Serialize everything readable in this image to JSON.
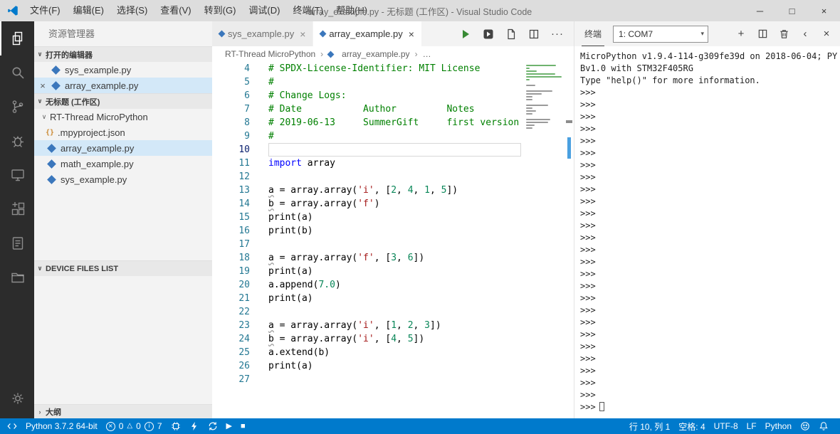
{
  "window": {
    "title": "array_example.py - 无标题 (工作区) - Visual Studio Code",
    "menus": [
      {
        "id": "file",
        "label": "文件(F)"
      },
      {
        "id": "edit",
        "label": "编辑(E)"
      },
      {
        "id": "selection",
        "label": "选择(S)"
      },
      {
        "id": "view",
        "label": "查看(V)"
      },
      {
        "id": "goto",
        "label": "转到(G)"
      },
      {
        "id": "debug",
        "label": "调试(D)"
      },
      {
        "id": "terminal",
        "label": "终端(T)"
      },
      {
        "id": "help",
        "label": "帮助(H)"
      }
    ]
  },
  "activity_bar": {
    "items": [
      {
        "id": "explorer",
        "active": true
      },
      {
        "id": "search",
        "active": false
      },
      {
        "id": "source-control",
        "active": false
      },
      {
        "id": "debug",
        "active": false
      },
      {
        "id": "device",
        "active": false
      },
      {
        "id": "extensions",
        "active": false
      },
      {
        "id": "notes",
        "active": false
      },
      {
        "id": "folders",
        "active": false
      }
    ],
    "bottom": [
      {
        "id": "gear"
      }
    ]
  },
  "sidebar": {
    "title": "资源管理器",
    "sections": {
      "open_editors": {
        "label": "打开的编辑器",
        "items": [
          {
            "label": "sys_example.py",
            "selected": false,
            "show_close": false
          },
          {
            "label": "array_example.py",
            "selected": true,
            "show_close": true
          }
        ]
      },
      "workspace": {
        "label": "无标题 (工作区)",
        "tree": [
          {
            "label": "RT-Thread MicroPython",
            "kind": "folder",
            "level": 0,
            "selected": false
          },
          {
            "label": ".mpyproject.json",
            "kind": "json",
            "level": 1,
            "selected": false
          },
          {
            "label": "array_example.py",
            "kind": "py",
            "level": 1,
            "selected": true
          },
          {
            "label": "math_example.py",
            "kind": "py",
            "level": 1,
            "selected": false
          },
          {
            "label": "sys_example.py",
            "kind": "py",
            "level": 1,
            "selected": false
          }
        ]
      },
      "device_files": {
        "label": "DEVICE FILES LIST"
      },
      "outline": {
        "label": "大纲"
      }
    }
  },
  "editor": {
    "tabs": [
      {
        "label": "sys_example.py",
        "active": false
      },
      {
        "label": "array_example.py",
        "active": true
      }
    ],
    "breadcrumb": [
      {
        "label": "RT-Thread MicroPython",
        "icon": null
      },
      {
        "label": "array_example.py",
        "icon": "py"
      },
      {
        "label": "…",
        "icon": null
      }
    ],
    "lines": [
      {
        "n": 4,
        "seg": [
          [
            "c",
            "# SPDX-License-Identifier: MIT License"
          ]
        ]
      },
      {
        "n": 5,
        "seg": [
          [
            "c",
            "#"
          ]
        ]
      },
      {
        "n": 6,
        "seg": [
          [
            "c",
            "# Change Logs:"
          ]
        ]
      },
      {
        "n": 7,
        "seg": [
          [
            "c",
            "# Date           Author         Notes"
          ]
        ]
      },
      {
        "n": 8,
        "seg": [
          [
            "c",
            "# 2019-06-13     SummerGift     first version"
          ]
        ]
      },
      {
        "n": 9,
        "seg": [
          [
            "c",
            "#"
          ]
        ]
      },
      {
        "n": 10,
        "cur": true,
        "seg": []
      },
      {
        "n": 11,
        "seg": [
          [
            "k",
            "import"
          ],
          [
            "v",
            " array"
          ]
        ]
      },
      {
        "n": 12,
        "seg": []
      },
      {
        "n": 13,
        "seg": [
          [
            "u",
            "a"
          ],
          [
            "v",
            " = array.array("
          ],
          [
            "s",
            "'i'"
          ],
          [
            "v",
            ", ["
          ],
          [
            "n",
            "2"
          ],
          [
            "v",
            ", "
          ],
          [
            "n",
            "4"
          ],
          [
            "v",
            ", "
          ],
          [
            "n",
            "1"
          ],
          [
            "v",
            ", "
          ],
          [
            "n",
            "5"
          ],
          [
            "v",
            "])"
          ]
        ]
      },
      {
        "n": 14,
        "seg": [
          [
            "u",
            "b"
          ],
          [
            "v",
            " = array.array("
          ],
          [
            "s",
            "'f'"
          ],
          [
            "v",
            ")"
          ]
        ]
      },
      {
        "n": 15,
        "seg": [
          [
            "v",
            "print(a)"
          ]
        ]
      },
      {
        "n": 16,
        "seg": [
          [
            "v",
            "print(b)"
          ]
        ]
      },
      {
        "n": 17,
        "seg": []
      },
      {
        "n": 18,
        "seg": [
          [
            "u",
            "a"
          ],
          [
            "v",
            " = array.array("
          ],
          [
            "s",
            "'f'"
          ],
          [
            "v",
            ", ["
          ],
          [
            "n",
            "3"
          ],
          [
            "v",
            ", "
          ],
          [
            "n",
            "6"
          ],
          [
            "v",
            "])"
          ]
        ]
      },
      {
        "n": 19,
        "seg": [
          [
            "v",
            "print(a)"
          ]
        ]
      },
      {
        "n": 20,
        "seg": [
          [
            "v",
            "a.append("
          ],
          [
            "n",
            "7.0"
          ],
          [
            "v",
            ")"
          ]
        ]
      },
      {
        "n": 21,
        "seg": [
          [
            "v",
            "print(a)"
          ]
        ]
      },
      {
        "n": 22,
        "seg": []
      },
      {
        "n": 23,
        "seg": [
          [
            "u",
            "a"
          ],
          [
            "v",
            " = array.array("
          ],
          [
            "s",
            "'i'"
          ],
          [
            "v",
            ", ["
          ],
          [
            "n",
            "1"
          ],
          [
            "v",
            ", "
          ],
          [
            "n",
            "2"
          ],
          [
            "v",
            ", "
          ],
          [
            "n",
            "3"
          ],
          [
            "v",
            "])"
          ]
        ]
      },
      {
        "n": 24,
        "seg": [
          [
            "u",
            "b"
          ],
          [
            "v",
            " = array.array("
          ],
          [
            "s",
            "'i'"
          ],
          [
            "v",
            ", ["
          ],
          [
            "n",
            "4"
          ],
          [
            "v",
            ", "
          ],
          [
            "n",
            "5"
          ],
          [
            "v",
            "])"
          ]
        ]
      },
      {
        "n": 25,
        "seg": [
          [
            "v",
            "a.extend(b)"
          ]
        ]
      },
      {
        "n": 26,
        "seg": [
          [
            "v",
            "print(a)"
          ]
        ]
      },
      {
        "n": 27,
        "seg": []
      }
    ]
  },
  "terminal": {
    "title": "终端",
    "dropdown_value": "1: COM7",
    "banner": [
      "MicroPython v1.9.4-114-g309fe39d on 2018-06-04; PY",
      "Bv1.0 with STM32F405RG",
      "Type \"help()\" for more information."
    ],
    "prompt": ">>>",
    "prompt_count": 26
  },
  "status_bar": {
    "left": {
      "interpreter": "Python 3.7.2 64-bit",
      "errors": "0",
      "warnings": "0",
      "infos": "7"
    },
    "right": {
      "cursor": "行 10, 列 1",
      "indent": "空格: 4",
      "encoding": "UTF-8",
      "eol": "LF",
      "language": "Python"
    }
  },
  "colors": {
    "accent": "#007acc",
    "activity_bar_bg": "#2c2c2c",
    "titlebar_bg": "#dddddd",
    "sidebar_bg": "#f3f3f3",
    "selection_bg": "#d3e8f8",
    "comment": "#008000",
    "keyword": "#0000ff",
    "string": "#a31515",
    "number": "#098658",
    "python_icon": "#3b77bc",
    "json_icon": "#cc8a33",
    "run_icon": "#388a34"
  }
}
